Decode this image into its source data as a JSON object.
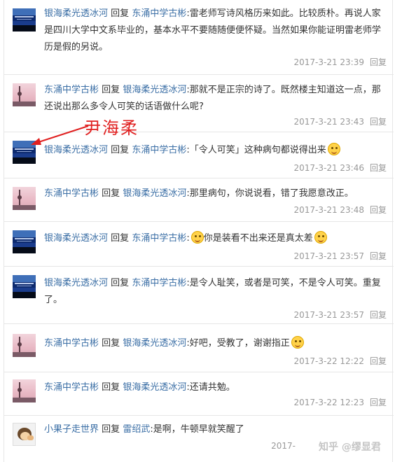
{
  "annotation": {
    "label": "尹海柔"
  },
  "watermark": "知乎 @缪显君",
  "reply_label": "回复",
  "comments": [
    {
      "user": "银海柔光透冰河",
      "verb": "回复",
      "target": "东涌中学古彬",
      "text": ":雷老师写诗风格历来如此。比较质朴。再说人家是四川大学中文系毕业的，基本水平不要随随便便怀疑。当然如果你能证明雷老师学历是假的另说。",
      "time": "2017-3-21 23:39",
      "reply": "回复",
      "avatar": "blue-avatar"
    },
    {
      "user": "东涌中学古彬",
      "verb": "回复",
      "target": "银海柔光透冰河",
      "text": ":那就不是正宗的诗了。既然楼主知道这一点，那还说出那么多令人可笑的话语做什么呢?",
      "time": "2017-3-21 23:43",
      "reply": "回复",
      "avatar": "tower-avatar"
    },
    {
      "user": "银海柔光透冰河",
      "verb": "回复",
      "target": "东涌中学古彬",
      "text": ":「令人可笑」这种病句都说得出来",
      "time": "2017-3-21 23:46",
      "reply": "回复",
      "avatar": "blue-avatar",
      "emoji": "smile-emoji"
    },
    {
      "user": "东涌中学古彬",
      "verb": "回复",
      "target": "银海柔光透冰河",
      "text": ":那里病句，你说说看，错了我愿意改正。",
      "time": "2017-3-21 23:48",
      "reply": "回复",
      "avatar": "tower-avatar"
    },
    {
      "user": "银海柔光透冰河",
      "verb": "回复",
      "target": "东涌中学古彬",
      "text_before": ":",
      "text": "你是装看不出来还是真太差",
      "time": "2017-3-21 23:57",
      "reply": "回复",
      "avatar": "blue-avatar",
      "emoji_before": "grin-emoji",
      "emoji": "laugh-emoji"
    },
    {
      "user": "银海柔光透冰河",
      "verb": "回复",
      "target": "东涌中学古彬",
      "text": ":是令人耻笑，或者是可笑，不是令人可笑。重复了。",
      "time": "2017-3-21 23:57",
      "reply": "回复",
      "avatar": "blue-avatar"
    },
    {
      "user": "东涌中学古彬",
      "verb": "回复",
      "target": "银海柔光透冰河",
      "text": ":好吧，受教了，谢谢指正",
      "time": "2017-3-22 12:22",
      "reply": "回复",
      "avatar": "tower-avatar",
      "emoji": "bow-emoji"
    },
    {
      "user": "东涌中学古彬",
      "verb": "回复",
      "target": "银海柔光透冰河",
      "text": ":还请共勉。",
      "time": "2017-3-22 12:23",
      "reply": "回复",
      "avatar": "tower-avatar"
    },
    {
      "user": "小果子走世界",
      "verb": "回复",
      "target": "雷绍武",
      "text": ":是啊，牛顿早就笑醒了",
      "time": "2017-",
      "reply": "",
      "avatar": "fruit-avatar"
    }
  ]
}
